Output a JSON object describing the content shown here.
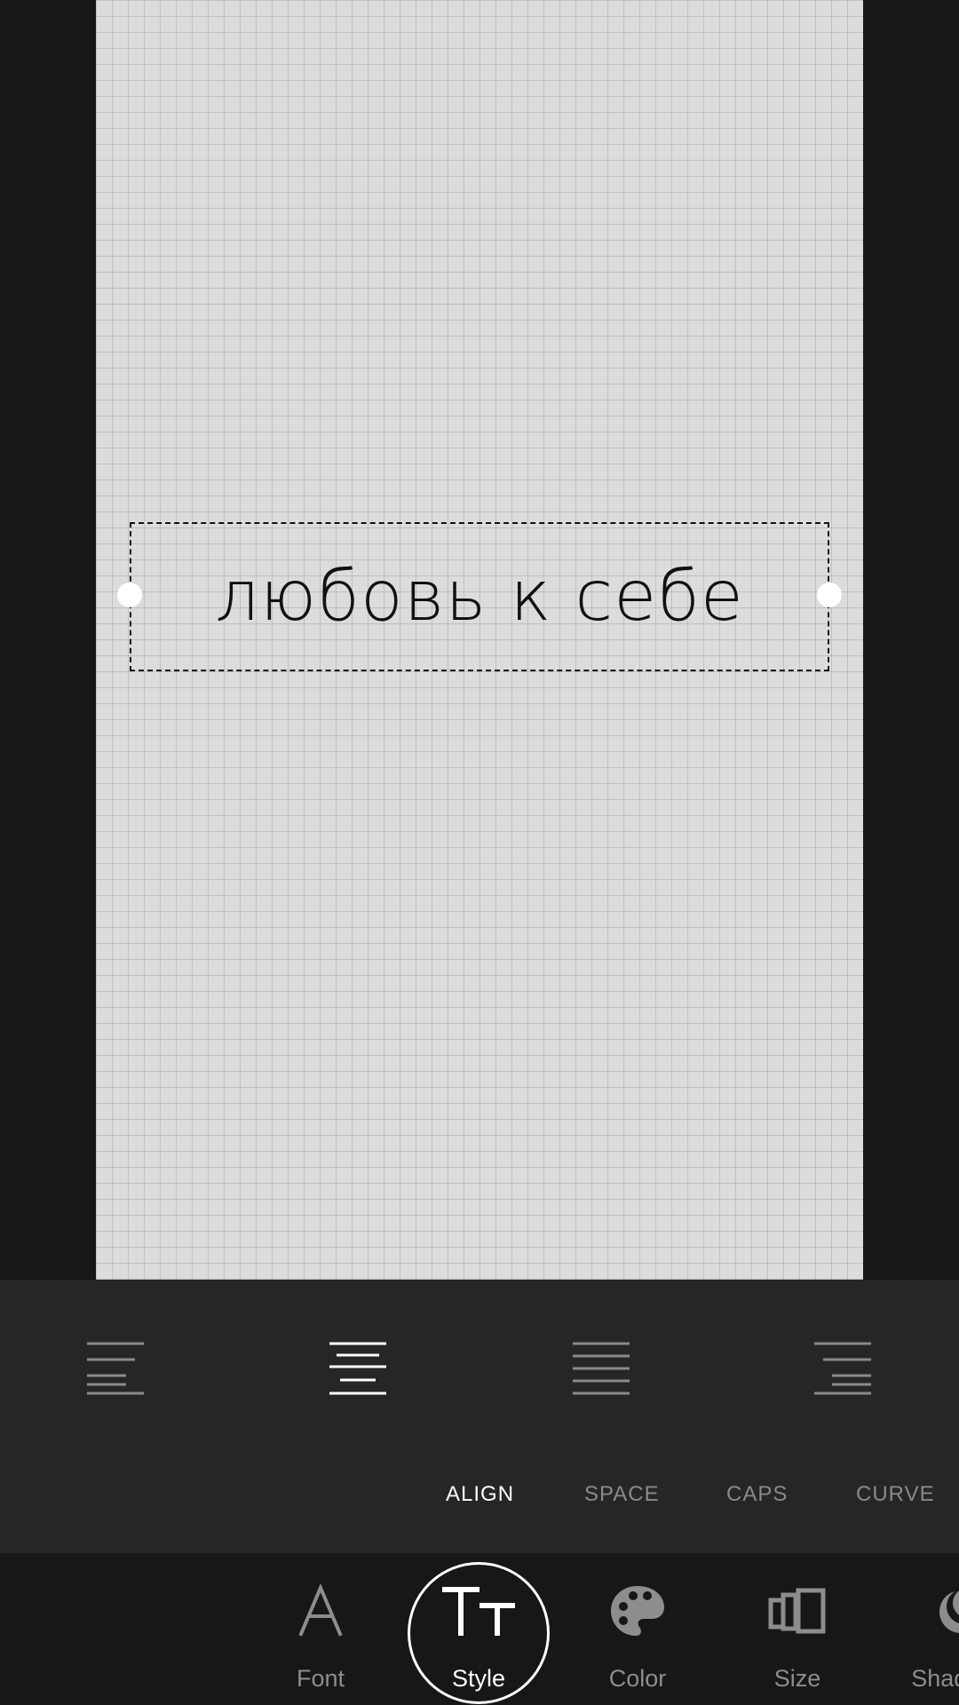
{
  "canvas": {
    "text": "любовь к себе"
  },
  "align_panel": {
    "buttons": [
      {
        "name": "align-left",
        "active": false
      },
      {
        "name": "align-center",
        "active": true
      },
      {
        "name": "align-justify",
        "active": false
      },
      {
        "name": "align-right",
        "active": false
      }
    ],
    "subtabs": [
      {
        "label": "ALIGN",
        "active": true
      },
      {
        "label": "SPACE",
        "active": false
      },
      {
        "label": "CAPS",
        "active": false
      },
      {
        "label": "CURVE",
        "active": false
      }
    ]
  },
  "toolbar": {
    "tools": [
      {
        "label": "Font",
        "icon": "font-a-icon",
        "active": false
      },
      {
        "label": "Style",
        "icon": "text-style-tt-icon",
        "active": true
      },
      {
        "label": "Color",
        "icon": "palette-icon",
        "active": false
      },
      {
        "label": "Size",
        "icon": "size-frames-icon",
        "active": false
      },
      {
        "label": "Shadow",
        "icon": "shadow-icon",
        "active": false
      }
    ]
  },
  "colors": {
    "background": "#171717",
    "panel": "#262626",
    "canvas": "#dcdcdc",
    "active": "#ffffff",
    "inactive": "#8d8d8d"
  }
}
